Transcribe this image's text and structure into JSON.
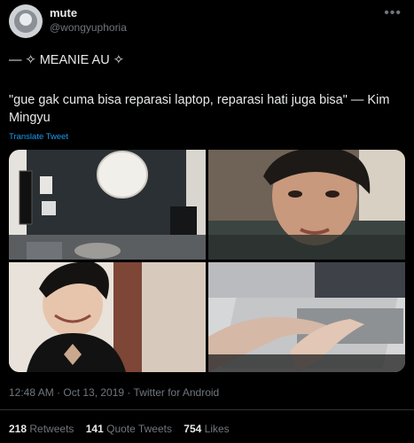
{
  "user": {
    "name": "mute",
    "handle": "@wongyuphoria"
  },
  "tweet": {
    "line1": "— ✧ MEANIE AU ✧",
    "quote": "\"gue gak cuma bisa reparasi laptop, reparasi hati juga bisa\" — Kim Mingyu",
    "translate_label": "Translate Tweet",
    "images": [
      {
        "icon": "room-photo"
      },
      {
        "icon": "selfie-photo"
      },
      {
        "icon": "smiling-person-photo"
      },
      {
        "icon": "laptop-typing-photo"
      }
    ],
    "timestamp": "12:48 AM · Oct 13, 2019 · Twitter for Android"
  },
  "stats": {
    "retweets_count": "218",
    "retweets_label": "Retweets",
    "quote_tweets_count": "141",
    "quote_tweets_label": "Quote Tweets",
    "likes_count": "754",
    "likes_label": "Likes"
  },
  "colors": {
    "background": "#000000",
    "text": "#e7e9ea",
    "muted": "#71767b",
    "link": "#1d9bf0"
  }
}
